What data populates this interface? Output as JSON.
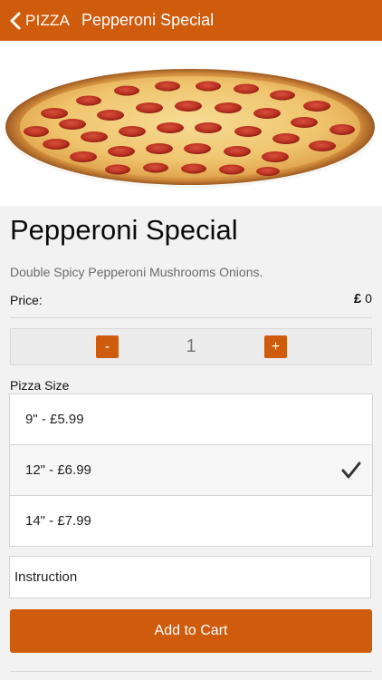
{
  "nav": {
    "back_label": "PIZZA",
    "title": "Pepperoni Special"
  },
  "product": {
    "name": "Pepperoni Special",
    "description": "Double Spicy Pepperoni Mushrooms Onions.",
    "price_label": "Price:",
    "currency_symbol": "£",
    "price_value": "0"
  },
  "quantity": {
    "minus_label": "-",
    "value": "1",
    "plus_label": "+"
  },
  "size_section": {
    "label": "Pizza Size",
    "options": [
      {
        "label": "9\" - £5.99",
        "selected": false
      },
      {
        "label": "12\" - £6.99",
        "selected": true
      },
      {
        "label": "14\" - £7.99",
        "selected": false
      }
    ]
  },
  "instruction": {
    "placeholder": "Instruction"
  },
  "cart": {
    "add_label": "Add to Cart"
  },
  "colors": {
    "accent": "#cf5b0d",
    "background": "#f2f2f2"
  },
  "icons": {
    "back": "chevron-left-icon",
    "check": "checkmark-icon",
    "image": "pizza-image"
  }
}
